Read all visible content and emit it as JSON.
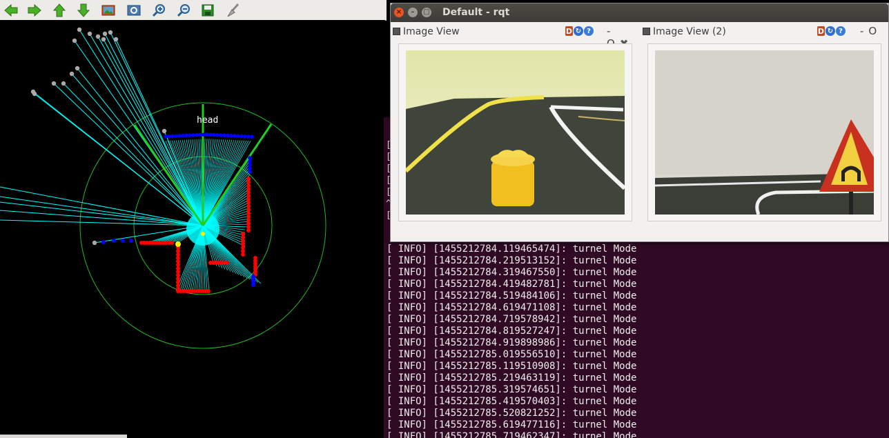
{
  "toolbar": {
    "buttons": [
      {
        "icon": "arrow-left-icon"
      },
      {
        "icon": "arrow-right-icon"
      },
      {
        "icon": "arrow-up-icon"
      },
      {
        "icon": "arrow-down-icon"
      },
      {
        "icon": "image-icon"
      },
      {
        "icon": "zoom-fit-icon"
      },
      {
        "icon": "zoom-in-icon"
      },
      {
        "icon": "zoom-out-icon"
      },
      {
        "icon": "save-icon"
      },
      {
        "icon": "clear-brush-icon"
      }
    ]
  },
  "viewer": {
    "head_label": "head"
  },
  "rqt": {
    "title": "Default - rqt",
    "docks": [
      {
        "title": "Image View"
      },
      {
        "title": "Image View (2)"
      }
    ],
    "dock_icon_letter": "D",
    "help_glyph": "?",
    "minimize_glyph": "-",
    "float_glyph": "O",
    "close_glyph": "✖"
  },
  "terminal": {
    "prompt_lines": [
      "[",
      "[",
      "[",
      "[",
      "[",
      "^",
      "["
    ],
    "log": [
      "[ INFO] [1455212784.119465474]: turnel Mode",
      "[ INFO] [1455212784.219513152]: turnel Mode",
      "[ INFO] [1455212784.319467550]: turnel Mode",
      "[ INFO] [1455212784.419482781]: turnel Mode",
      "[ INFO] [1455212784.519484106]: turnel Mode",
      "[ INFO] [1455212784.619471108]: turnel Mode",
      "[ INFO] [1455212784.719578942]: turnel Mode",
      "[ INFO] [1455212784.819527247]: turnel Mode",
      "[ INFO] [1455212784.919898986]: turnel Mode",
      "[ INFO] [1455212785.019556510]: turnel Mode",
      "[ INFO] [1455212785.119510908]: turnel Mode",
      "[ INFO] [1455212785.219463119]: turnel Mode",
      "[ INFO] [1455212785.319574651]: turnel Mode",
      "[ INFO] [1455212785.419570403]: turnel Mode",
      "[ INFO] [1455212785.520821252]: turnel Mode",
      "[ INFO] [1455212785.619477116]: turnel Mode",
      "[ INFO] [1455212785.719462347]: turnel Mode"
    ]
  },
  "colors": {
    "terminal_bg": "#300a24",
    "scan_rays": "#00ffff",
    "fov_lines": "#22cc22",
    "range_rings": "#22bb22",
    "obstacle_red": "#ff0000",
    "obstacle_blue": "#0000ff",
    "far_points": "#aaaaaa",
    "target_yellow": "#ffee00"
  }
}
